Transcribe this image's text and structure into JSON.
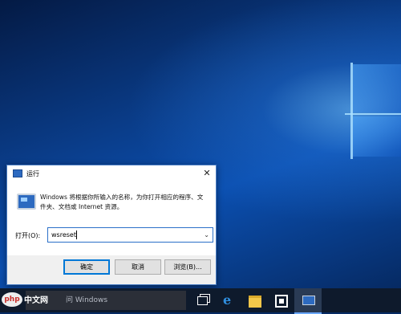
{
  "dialog": {
    "title": "运行",
    "close_glyph": "✕",
    "description": "Windows 将根据你所输入的名称，为你打开相应的程序、文件夹、文档或 Internet 资源。",
    "open_label": "打开(O):",
    "command_value": "wsreset",
    "dropdown_glyph": "⌄",
    "buttons": {
      "ok": "确定",
      "cancel": "取消",
      "browse": "浏览(B)..."
    }
  },
  "taskbar": {
    "search_text": "问 Windows",
    "edge_glyph": "e"
  },
  "watermark": {
    "logo": "php",
    "text": "中文网"
  },
  "icons": [
    "windows-run-icon",
    "close-icon",
    "chevron-down-icon",
    "task-view-icon",
    "edge-icon",
    "file-explorer-icon",
    "store-icon",
    "run-taskbar-icon"
  ],
  "colors": {
    "desktop": "#0b4fb0",
    "accent": "#0078d7",
    "taskbar": "#0e1a2c"
  }
}
